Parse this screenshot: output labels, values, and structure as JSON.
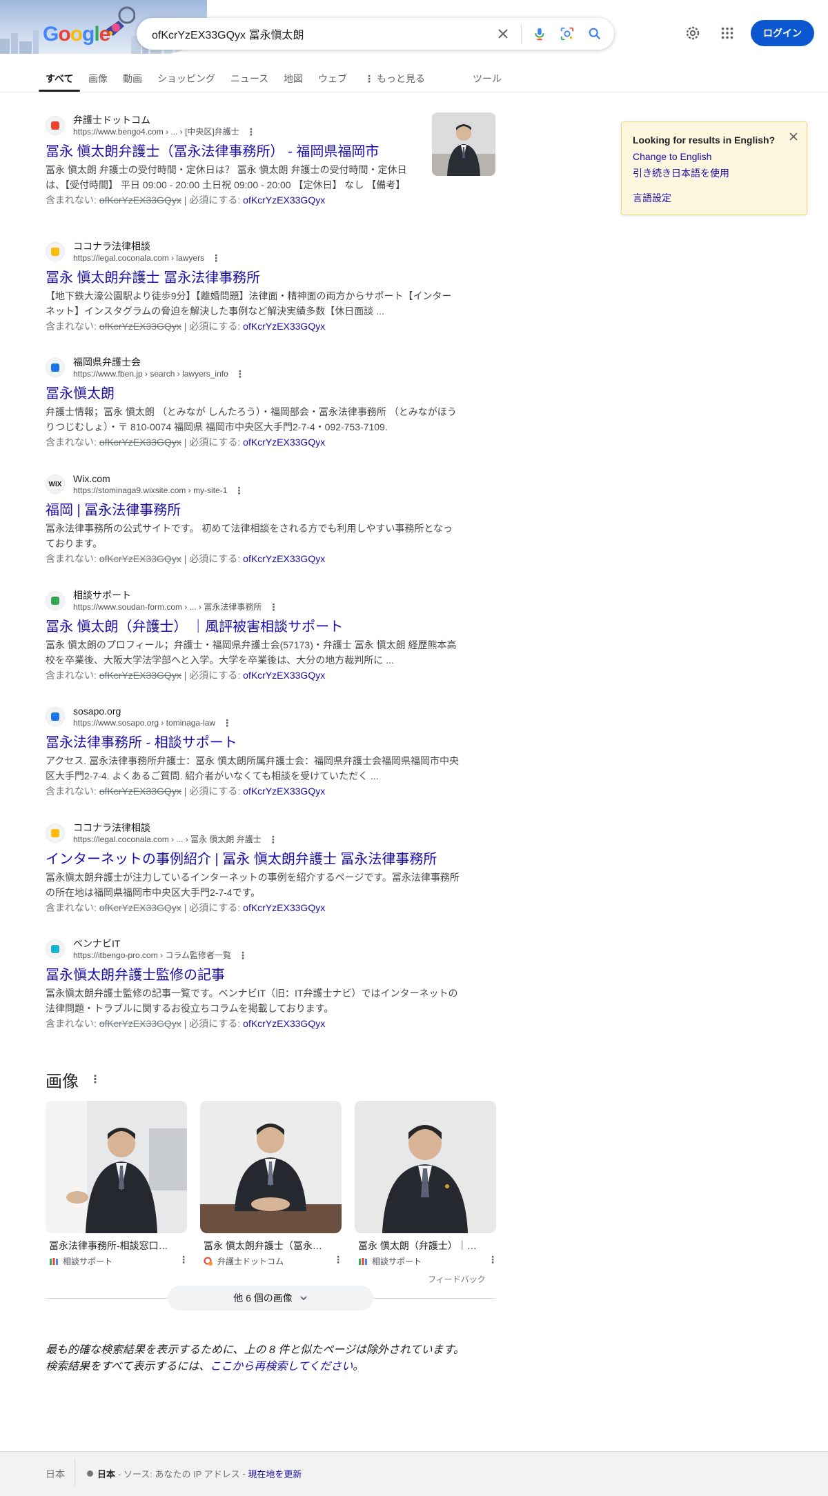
{
  "header": {
    "logo_letters": [
      "G",
      "o",
      "o",
      "g",
      "l",
      "e"
    ],
    "search_query": "ofKcrYzEX33GQyx 冨永愼太朗",
    "login_label": "ログイン",
    "icons": [
      "close-icon",
      "mic-icon",
      "lens-icon",
      "search-icon",
      "gear-icon",
      "apps-icon"
    ]
  },
  "tabs": [
    {
      "label": "すべて",
      "active": true
    },
    {
      "label": "画像"
    },
    {
      "label": "動画"
    },
    {
      "label": "ショッピング"
    },
    {
      "label": "ニュース"
    },
    {
      "label": "地図"
    },
    {
      "label": "ウェブ"
    },
    {
      "label": "もっと見る"
    },
    {
      "label": "ツール"
    }
  ],
  "results": [
    {
      "site_name": "弁護士ドットコム",
      "url": "https://www.bengo4.com › ... › [中央区]弁護士",
      "title": "冨永 愼太朗弁護士（冨永法律事務所） - 福岡県福岡市",
      "snippet": "冨永 愼太朗 弁護士の受付時間・定休日は？ 冨永 愼太朗 弁護士の受付時間・定休日は、【受付時間】 平日 09:00 - 20:00 土日祝 09:00 - 20:00 【定休日】 なし 【備考】",
      "favicon_color": "#ea4335"
    },
    {
      "site_name": "ココナラ法律相談",
      "url": "https://legal.coconala.com › lawyers",
      "title": "冨永 愼太朗弁護士 冨永法律事務所",
      "snippet": "【地下鉄大濠公園駅より徒歩9分】【離婚問題】法律面・精神面の両方からサポート【インターネット】インスタグラムの脅迫を解決した事例など解決実績多数【休日面談 ...",
      "favicon_color": "#fbbc05"
    },
    {
      "site_name": "福岡県弁護士会",
      "url": "https://www.fben.jp › search › lawyers_info",
      "title": "冨永愼太朗",
      "snippet": "弁護士情報；冨永 愼太朗 （とみなが しんたろう）・福岡部会・冨永法律事務所 （とみながほうりつじむしょ）・〒 810-0074 福岡県 福岡市中央区大手門2-7-4・092-753-7109.",
      "favicon_color": "#1a73e8"
    },
    {
      "site_name": "Wix.com",
      "url": "https://stominaga9.wixsite.com › my-site-1",
      "title": "福岡 | 冨永法律事務所",
      "snippet": "冨永法律事務所の公式サイトです。 初めて法律相談をされる方でも利用しやすい事務所となっております。",
      "favicon_label": "WIX",
      "favicon_color": "#202124"
    },
    {
      "site_name": "相談サポート",
      "url": "https://www.soudan-form.com › ... › 冨永法律事務所",
      "title": "冨永 愼太朗（弁護士） ｜風評被害相談サポート",
      "snippet": "冨永 愼太朗のプロフィール；弁護士・福岡県弁護士会(57173)・弁護士 冨永 愼太朗 経歴熊本高校を卒業後、大阪大学法学部へと入学。大学を卒業後は、大分の地方裁判所に ...",
      "favicon_color": "#34a853"
    },
    {
      "site_name": "sosapo.org",
      "url": "https://www.sosapo.org › tominaga-law",
      "title": "冨永法律事務所 - 相談サポート",
      "snippet": "アクセス. 冨永法律事務所弁護士：冨永 愼太朗所属弁護士会：福岡県弁護士会福岡県福岡市中央区大手門2-7-4. よくあるご質問. 紹介者がいなくても相談を受けていただく ...",
      "favicon_color": "#1a73e8"
    },
    {
      "site_name": "ココナラ法律相談",
      "url": "https://legal.coconala.com › ... › 冨永 愼太朗 弁護士",
      "title": "インターネットの事例紹介 | 冨永 愼太朗弁護士 冨永法律事務所",
      "snippet": "冨永愼太朗弁護士が注力しているインターネットの事例を紹介するページです。冨永法律事務所の所在地は福岡県福岡市中央区大手門2-7-4です。",
      "favicon_color": "#fbbc05"
    },
    {
      "site_name": "ベンナビIT",
      "url": "https://itbengo-pro.com › コラム監修者一覧",
      "title": "冨永愼太朗弁護士監修の記事",
      "snippet": "冨永愼太朗弁護士監修の記事一覧です。ベンナビIT（旧：IT弁護士ナビ）ではインターネットの法律問題・トラブルに関するお役立ちコラムを掲載しております。",
      "favicon_color": "#12b5cb"
    }
  ],
  "missing_prefix": "含まれない: ",
  "missing_term": "ofKcrYzEX33GQyx",
  "required_prefix": " | 必須にする: ",
  "required_term": "ofKcrYzEX33GQyx",
  "english_card": {
    "title": "Looking for results in English?",
    "change_link": "Change to English",
    "keep_link": "引き続き日本語を使用",
    "settings_link": "言語設定"
  },
  "images_section": {
    "heading": "画像",
    "items": [
      {
        "caption": "冨永法律事務所-相談窓口（...",
        "source": "相談サポート"
      },
      {
        "caption": "冨永 愼太朗弁護士（冨永法...",
        "source": "弁護士ドットコム"
      },
      {
        "caption": "冨永 愼太朗（弁護士）｜風...",
        "source": "相談サポート"
      }
    ],
    "feedback": "フィードバック",
    "more_button": "他 6 個の画像"
  },
  "omitted_notice": {
    "line1": "最も的確な検索結果を表示するために、上の 8 件と似たページは除外されています。",
    "line2_prefix": "検索結果をすべて表示するには、",
    "line2_link": "ここから再検索してください",
    "line2_suffix": "。"
  },
  "footer": {
    "country": "日本",
    "location_bold": "日本",
    "location_source": "- ソース: あなたの IP アドレス",
    "location_sep": " - ",
    "update_link": "現在地を更新"
  },
  "colors": {
    "link": "#1a0dab",
    "login_bg": "#0b57d0",
    "card_bg": "#fef7e0"
  }
}
